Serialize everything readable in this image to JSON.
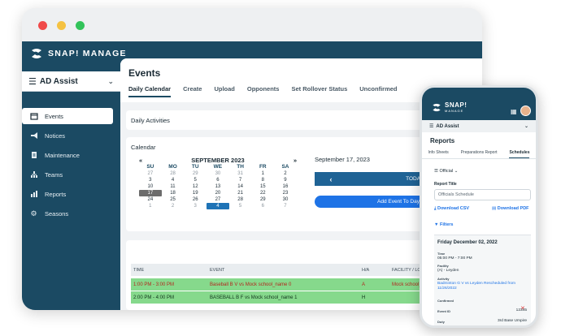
{
  "window": {
    "brand": "SNAP! MANAGE"
  },
  "sidebar": {
    "selector": "AD Assist",
    "items": [
      {
        "label": "Events",
        "icon": "calendar-icon"
      },
      {
        "label": "Notices",
        "icon": "megaphone-icon"
      },
      {
        "label": "Maintenance",
        "icon": "clipboard-icon"
      },
      {
        "label": "Teams",
        "icon": "teams-icon"
      },
      {
        "label": "Reports",
        "icon": "chart-icon"
      },
      {
        "label": "Seasons",
        "icon": "gear-icon"
      }
    ]
  },
  "main": {
    "title": "Events",
    "tabs": [
      "Daily Calendar",
      "Create",
      "Upload",
      "Opponents",
      "Set Rollover Status",
      "Unconfirmed"
    ],
    "daily_activities": "Daily Activities",
    "calendar": {
      "title": "Calendar",
      "prev": "«",
      "month": "SEPTEMBER 2023",
      "next": "»",
      "dow": [
        "SU",
        "MO",
        "TU",
        "WE",
        "TH",
        "FR",
        "SA"
      ],
      "weeks": [
        [
          "27",
          "28",
          "29",
          "30",
          "31",
          "1",
          "2"
        ],
        [
          "3",
          "4",
          "5",
          "6",
          "7",
          "8",
          "9"
        ],
        [
          "10",
          "11",
          "12",
          "13",
          "14",
          "15",
          "16"
        ],
        [
          "17",
          "18",
          "19",
          "20",
          "21",
          "22",
          "23"
        ],
        [
          "24",
          "25",
          "26",
          "27",
          "28",
          "29",
          "30"
        ],
        [
          "1",
          "2",
          "3",
          "4",
          "5",
          "6",
          "7"
        ]
      ],
      "selected_date": "September 17, 2023",
      "today_label": "TODAY",
      "add_event": "Add Event To Day"
    },
    "table": {
      "headers": [
        "TIME",
        "EVENT",
        "H/A",
        "FACILITY / LO"
      ],
      "rows": [
        {
          "time": "1:00 PM - 3:00 PM",
          "event": "Baseball B V vs Mock school_name 0",
          "ha": "A",
          "facility": "Mock school_"
        },
        {
          "time": "2:00 PM - 4:00 PM",
          "event": "BASEBALL B F vs Mock school_name 1",
          "ha": "H",
          "facility": ""
        }
      ]
    }
  },
  "phone": {
    "brand_top": "SNAP!",
    "brand_bottom": "MANAGE",
    "selector": "AD Assist",
    "title": "Reports",
    "tabs": [
      "Info Sheets",
      "Preparations Report",
      "Schedules"
    ],
    "report_type": "Official",
    "report_title_label": "Report Title",
    "report_title_value": "Officials Schedule",
    "download_csv": "Download CSV",
    "download_pdf": "Download PDF",
    "filters": "Filters",
    "day": "Friday December 02, 2022",
    "time_label": "Time",
    "time_value": "05:00 PM - 7:00 PM",
    "facility_label": "Facility",
    "facility_value": "(A) - Leyden",
    "activity_label": "Activity",
    "activity_value": "Badminton G V vs Leyden Rescheduled from 11/26/2022",
    "confirmed_label": "Confirmed",
    "event_id_label": "Event ID",
    "event_id_value": "12345",
    "duty_label": "Duty",
    "duty_value": "3rd Base Umpire"
  }
}
